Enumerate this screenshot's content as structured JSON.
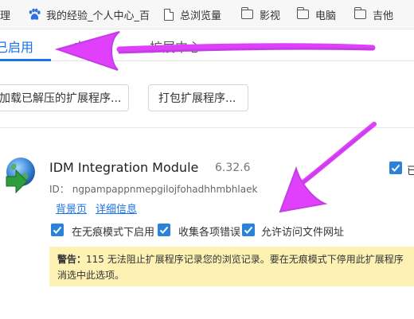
{
  "bookmarks": {
    "items": [
      {
        "icon": "partial-icon",
        "label": "理"
      },
      {
        "icon": "paw-icon",
        "label": "我的经验_个人中心_百"
      },
      {
        "icon": "document-icon",
        "label": "总浏览量"
      },
      {
        "icon": "folder-icon",
        "label": "影视"
      },
      {
        "icon": "folder-icon",
        "label": "电脑"
      },
      {
        "icon": "folder-icon",
        "label": "吉他"
      }
    ]
  },
  "tabs": [
    {
      "label": "已启用",
      "active": true
    },
    {
      "label": "未启用",
      "active": false
    },
    {
      "label": "扩展中心",
      "active": false
    }
  ],
  "buttons": {
    "load_unpacked": "加载已解压的扩展程序...",
    "pack_extension": "打包扩展程序..."
  },
  "extension": {
    "icon": "idm-globe-arrow-icon",
    "name": "IDM Integration Module",
    "version": "6.32.6",
    "id_label": "ID：",
    "id_value": "ngpampappnmepgilojfohadhhmbhlaek",
    "links": {
      "background_page": "背景页",
      "details": "详细信息"
    },
    "options": [
      {
        "label": "在无痕模式下启用",
        "checked": true
      },
      {
        "label": "收集各项错误",
        "checked": true
      },
      {
        "label": "允许访问文件网址",
        "checked": true
      }
    ],
    "enabled_checkbox": {
      "checked": true,
      "label": "已"
    },
    "warning": {
      "title": "警告：",
      "line1": "115 无法阻止扩展程序记录您的浏览记录。要在无痕模式下停用此扩展程序",
      "line2": "消选中此选项。"
    }
  },
  "colors": {
    "accent": "#1a73e8",
    "checkbox": "#2b82d9",
    "warning_bg": "#fdf1b4",
    "annotation_arrow": "#e040fb"
  }
}
